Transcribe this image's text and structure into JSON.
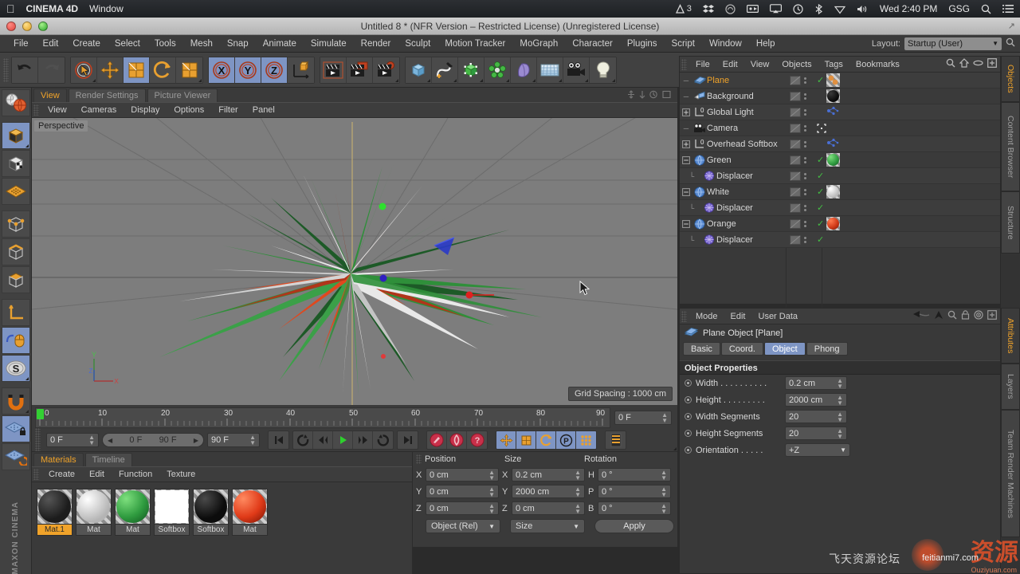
{
  "mac_menubar": {
    "apple_icon": "apple-icon",
    "app_name": "CINEMA 4D",
    "menus": [
      "Window"
    ],
    "status_items": [
      "adobe-icon",
      "dropbox-icon",
      "creative-cloud-icon",
      "screen-record-icon",
      "airplay-icon",
      "timemachine-icon",
      "bluetooth-icon",
      "shield-icon",
      "volume-icon"
    ],
    "badge_number": "3",
    "clock": "Wed 2:40 PM",
    "user": "GSG",
    "search_icon": "search-icon",
    "list_icon": "notification-center-icon"
  },
  "window": {
    "title": "Untitled 8 * (NFR Version – Restricted License) (Unregistered License)",
    "traffic_lights": [
      "close",
      "minimize",
      "zoom"
    ]
  },
  "menubar": {
    "items": [
      "File",
      "Edit",
      "Create",
      "Select",
      "Tools",
      "Mesh",
      "Snap",
      "Animate",
      "Simulate",
      "Render",
      "Sculpt",
      "Motion Tracker",
      "MoGraph",
      "Character",
      "Plugins",
      "Script",
      "Window",
      "Help"
    ],
    "layout_label": "Layout:",
    "layout_value": "Startup (User)"
  },
  "toolbar": {
    "groups": [
      {
        "name": "undo-redo",
        "buttons": [
          {
            "name": "undo-button",
            "icon": "undo-arrow-icon",
            "selected": false,
            "dim": false
          },
          {
            "name": "redo-button",
            "icon": "redo-arrow-icon",
            "selected": false,
            "dim": true
          }
        ]
      },
      {
        "name": "transform-tools",
        "buttons": [
          {
            "name": "live-selection-tool",
            "icon": "cursor-circle-icon",
            "selected": false,
            "dim": false
          },
          {
            "name": "move-tool",
            "icon": "move-arrows-icon",
            "selected": false,
            "dim": false
          },
          {
            "name": "scale-tool",
            "icon": "scale-box-icon",
            "selected": true,
            "dim": false
          },
          {
            "name": "rotate-tool",
            "icon": "rotate-circle-icon",
            "selected": false,
            "dim": false
          },
          {
            "name": "scale2-tool",
            "icon": "scale-box-icon",
            "selected": false,
            "dim": false
          }
        ]
      },
      {
        "name": "axis-locks",
        "buttons": [
          {
            "name": "lock-x-axis",
            "icon": "x-axis-icon",
            "selected": true,
            "dim": false
          },
          {
            "name": "lock-y-axis",
            "icon": "y-axis-icon",
            "selected": true,
            "dim": false
          },
          {
            "name": "lock-z-axis",
            "icon": "z-axis-icon",
            "selected": true,
            "dim": false
          },
          {
            "name": "world-object-coordinates",
            "icon": "coordinate-cube-icon",
            "selected": false,
            "dim": false
          }
        ]
      },
      {
        "name": "render-group",
        "buttons": [
          {
            "name": "render-view-button",
            "icon": "render-clapper-icon",
            "selected": false,
            "dim": false
          },
          {
            "name": "render-region-button",
            "icon": "render-region-icon",
            "selected": false,
            "dim": false
          },
          {
            "name": "render-settings-button",
            "icon": "render-settings-gear-icon",
            "selected": false,
            "dim": false
          }
        ]
      },
      {
        "name": "create-group",
        "buttons": [
          {
            "name": "add-cube-button",
            "icon": "cube-icon",
            "selected": false,
            "dim": false
          },
          {
            "name": "add-spline-button",
            "icon": "spline-pen-icon",
            "selected": false,
            "dim": false
          },
          {
            "name": "nurbs-button",
            "icon": "green-cube-icon",
            "selected": false,
            "dim": false
          },
          {
            "name": "array-button",
            "icon": "array-icon",
            "selected": false,
            "dim": false
          },
          {
            "name": "deformer-button",
            "icon": "bend-deformer-icon",
            "selected": false,
            "dim": false
          },
          {
            "name": "environment-button",
            "icon": "floor-grid-icon",
            "selected": false,
            "dim": false
          },
          {
            "name": "camera-button",
            "icon": "camera-icon",
            "selected": false,
            "dim": false
          },
          {
            "name": "light-button",
            "icon": "light-bulb-icon",
            "selected": false,
            "dim": false
          }
        ]
      }
    ]
  },
  "left_toolbar": {
    "buttons": [
      {
        "name": "render-mode-tool",
        "icon": "globe-render-icon",
        "selected": false
      },
      {
        "name": "model-mode-tool",
        "icon": "model-cube-icon",
        "selected": true
      },
      {
        "name": "texture-mode-tool",
        "icon": "texture-cube-icon",
        "selected": false
      },
      {
        "name": "workplane-tool",
        "icon": "workplane-grid-icon",
        "selected": false
      },
      {
        "name": "point-mode-tool",
        "icon": "point-mode-icon",
        "selected": false
      },
      {
        "name": "edge-mode-tool",
        "icon": "edge-mode-icon",
        "selected": false
      },
      {
        "name": "polygon-mode-tool",
        "icon": "polygon-mode-icon",
        "selected": false
      },
      {
        "name": "axis-mode-tool",
        "icon": "axis-corner-icon",
        "selected": false
      },
      {
        "name": "viewport-solo-tool",
        "icon": "mouse-icon",
        "selected": true
      },
      {
        "name": "selection-tool",
        "icon": "s-circle-icon",
        "selected": true
      },
      {
        "name": "snap-tool",
        "icon": "magnet-icon",
        "selected": false
      },
      {
        "name": "workplane-lock-tool",
        "icon": "grid-lock-icon",
        "selected": true
      },
      {
        "name": "workplane-rotate-tool",
        "icon": "grid-rotate-icon",
        "selected": false
      }
    ],
    "brand": "MAXON CINEMA"
  },
  "viewport": {
    "tabs": [
      {
        "label": "View",
        "active": true
      },
      {
        "label": "Render Settings",
        "active": false
      },
      {
        "label": "Picture Viewer",
        "active": false
      }
    ],
    "menus": [
      "View",
      "Cameras",
      "Display",
      "Options",
      "Filter",
      "Panel"
    ],
    "perspective_label": "Perspective",
    "grid_spacing": "Grid Spacing : 1000 cm",
    "axis_labels": {
      "y": "Y",
      "z": "Z",
      "x": "X"
    },
    "object_colors": {
      "green": "#2f8f3a",
      "dark_green": "#1d5a27",
      "white": "#e8e8e8",
      "light_gray": "#c4c4c4",
      "orange": "#e0481e",
      "dark_red": "#8f2a10",
      "background": "#7d7d7d"
    }
  },
  "timeline": {
    "ticks": [
      "0",
      "10",
      "20",
      "30",
      "40",
      "50",
      "60",
      "70",
      "80",
      "90"
    ],
    "current_frame_field": "0 F",
    "start_frame": "0 F",
    "range_start": "0 F",
    "range_end": "90 F",
    "end_frame": "90 F",
    "playback_buttons": [
      {
        "name": "go-to-start-button",
        "icon": "skip-start-icon"
      },
      {
        "name": "previous-keyframe-button",
        "icon": "prev-key-icon"
      },
      {
        "name": "step-back-button",
        "icon": "step-back-icon"
      },
      {
        "name": "play-button",
        "icon": "play-icon"
      },
      {
        "name": "step-forward-button",
        "icon": "step-forward-icon"
      },
      {
        "name": "next-keyframe-button",
        "icon": "next-key-icon"
      },
      {
        "name": "go-to-end-button",
        "icon": "skip-end-icon"
      }
    ],
    "record_buttons": [
      {
        "name": "record-keyframe-button",
        "icon": "record-key-icon"
      },
      {
        "name": "autokey-button",
        "icon": "autokey-icon"
      },
      {
        "name": "keyframe-selection-button",
        "icon": "question-key-icon"
      }
    ],
    "key_toggle_buttons": [
      {
        "name": "key-position-button",
        "icon": "move-arrows-icon",
        "selected": true
      },
      {
        "name": "key-scale-button",
        "icon": "scale-box-icon",
        "selected": true
      },
      {
        "name": "key-rotation-button",
        "icon": "rotate-circle-icon",
        "selected": true
      },
      {
        "name": "key-param-button",
        "icon": "p-circle-icon",
        "selected": true
      },
      {
        "name": "key-pla-button",
        "icon": "point-level-icon",
        "selected": true
      }
    ],
    "timeline_mode_button": {
      "name": "timeline-view-button",
      "icon": "timeline-bars-icon"
    }
  },
  "materials": {
    "tabs": [
      {
        "label": "Materials",
        "active": true
      },
      {
        "label": "Timeline",
        "active": false
      }
    ],
    "menus": [
      "Create",
      "Edit",
      "Function",
      "Texture"
    ],
    "items": [
      {
        "label": "Mat.1",
        "color": "#1c1c1c",
        "shape": "sphere",
        "selected": true
      },
      {
        "label": "Mat",
        "color": "#e4e4e4",
        "shape": "sphere",
        "selected": false
      },
      {
        "label": "Mat",
        "color": "#2f9b3f",
        "shape": "sphere",
        "selected": false
      },
      {
        "label": "Softbox",
        "color": "#ffffff",
        "shape": "square",
        "selected": false
      },
      {
        "label": "Softbox",
        "color": "#101010",
        "shape": "sphere",
        "selected": false
      },
      {
        "label": "Mat",
        "color": "#e03a18",
        "shape": "sphere",
        "selected": false
      }
    ]
  },
  "coordinates": {
    "headers": [
      "Position",
      "Size",
      "Rotation"
    ],
    "rows": [
      {
        "pos_axis": "X",
        "pos_value": "0 cm",
        "size_axis": "X",
        "size_value": "0.2 cm",
        "rot_axis": "H",
        "rot_value": "0 °"
      },
      {
        "pos_axis": "Y",
        "pos_value": "0 cm",
        "size_axis": "Y",
        "size_value": "2000 cm",
        "rot_axis": "P",
        "rot_value": "0 °"
      },
      {
        "pos_axis": "Z",
        "pos_value": "0 cm",
        "size_axis": "Z",
        "size_value": "0 cm",
        "rot_axis": "B",
        "rot_value": "0 °"
      }
    ],
    "mode_dropdown": "Object (Rel)",
    "size_dropdown": "Size",
    "apply_button": "Apply"
  },
  "object_manager": {
    "menus": [
      "File",
      "Edit",
      "View",
      "Objects",
      "Tags",
      "Bookmarks"
    ],
    "header_icons": [
      "search-icon",
      "home-icon",
      "ellipse-icon",
      "plus-box-icon"
    ],
    "objects": [
      {
        "name": "Plane",
        "icon": "plane-icon",
        "indent": 0,
        "expander": "none",
        "selected": true,
        "visible_dots": true,
        "check": true,
        "tag": {
          "type": "dual-sphere",
          "color": "#e09040"
        }
      },
      {
        "name": "Background",
        "icon": "background-icon",
        "indent": 0,
        "expander": "none",
        "selected": false,
        "visible_dots": true,
        "check": false,
        "tag": {
          "type": "sphere",
          "color": "#141414"
        }
      },
      {
        "name": "Global Light",
        "icon": "layer-icon",
        "indent": 0,
        "expander": "plus",
        "selected": false,
        "visible_dots": true,
        "check": false,
        "tag": {
          "type": "nodes",
          "color": "#4a6fd4"
        }
      },
      {
        "name": "Camera",
        "icon": "camera-icon",
        "indent": 0,
        "expander": "none",
        "selected": false,
        "visible_dots": true,
        "check": false,
        "tag": {
          "type": "target",
          "color": "#e8e8e8"
        }
      },
      {
        "name": "Overhead Softbox",
        "icon": "layer-icon",
        "indent": 0,
        "expander": "plus",
        "selected": false,
        "visible_dots": true,
        "check": false,
        "tag": {
          "type": "nodes",
          "color": "#4a6fd4"
        }
      },
      {
        "name": "Green",
        "icon": "sphere-obj-icon",
        "indent": 0,
        "expander": "minus",
        "selected": false,
        "visible_dots": true,
        "check": true,
        "tag": {
          "type": "sphere",
          "color": "#2f9b3f"
        }
      },
      {
        "name": "Displacer",
        "icon": "displacer-icon",
        "indent": 1,
        "expander": "child",
        "selected": false,
        "visible_dots": true,
        "check": true,
        "tag": null
      },
      {
        "name": "White",
        "icon": "sphere-obj-icon",
        "indent": 0,
        "expander": "minus",
        "selected": false,
        "visible_dots": true,
        "check": true,
        "tag": {
          "type": "sphere",
          "color": "#e4e4e4"
        }
      },
      {
        "name": "Displacer",
        "icon": "displacer-icon",
        "indent": 1,
        "expander": "child",
        "selected": false,
        "visible_dots": true,
        "check": true,
        "tag": null
      },
      {
        "name": "Orange",
        "icon": "sphere-obj-icon",
        "indent": 0,
        "expander": "minus",
        "selected": false,
        "visible_dots": true,
        "check": true,
        "tag": {
          "type": "sphere",
          "color": "#d03a18"
        }
      },
      {
        "name": "Displacer",
        "icon": "displacer-icon",
        "indent": 1,
        "expander": "child",
        "selected": false,
        "visible_dots": true,
        "check": true,
        "tag": null
      }
    ]
  },
  "attributes": {
    "menus": [
      "Mode",
      "Edit",
      "User Data"
    ],
    "header_icons": [
      "back-arrow-icon",
      "up-arrow-icon",
      "search-icon",
      "lock-icon",
      "target-icon",
      "plus-box-icon"
    ],
    "object_title": "Plane Object [Plane]",
    "tabs": [
      {
        "label": "Basic",
        "active": false
      },
      {
        "label": "Coord.",
        "active": false
      },
      {
        "label": "Object",
        "active": true
      },
      {
        "label": "Phong",
        "active": false
      }
    ],
    "section_title": "Object Properties",
    "properties": [
      {
        "label": "Width . . . . . . . . . .",
        "value": "0.2 cm",
        "type": "number"
      },
      {
        "label": "Height . . . . . . . . .",
        "value": "2000 cm",
        "type": "number"
      },
      {
        "label": "Width Segments",
        "value": "20",
        "type": "number"
      },
      {
        "label": "Height Segments",
        "value": "20",
        "type": "number"
      },
      {
        "label": "Orientation . . . . .",
        "value": "+Z",
        "type": "dropdown"
      }
    ]
  },
  "side_tabs": {
    "upper": [
      {
        "label": "Objects",
        "active": true
      },
      {
        "label": "Content Browser",
        "active": false
      },
      {
        "label": "Structure",
        "active": false
      }
    ],
    "lower": [
      {
        "label": "Attributes",
        "active": true
      },
      {
        "label": "Layers",
        "active": false
      },
      {
        "label": "Team Render Machines",
        "active": false
      }
    ]
  },
  "watermark": {
    "cn_text": "飞天资源论坛",
    "big_text": "资源",
    "url": "Ouziyuan.com",
    "url2": "feitianmi7.com"
  },
  "colors": {
    "accent_orange": "#f0a32a",
    "selection_blue": "#7e95c4",
    "panel_bg": "#3a3a3a",
    "toolbar_bg": "#414141",
    "viewport_bg": "#7d7d7d"
  }
}
